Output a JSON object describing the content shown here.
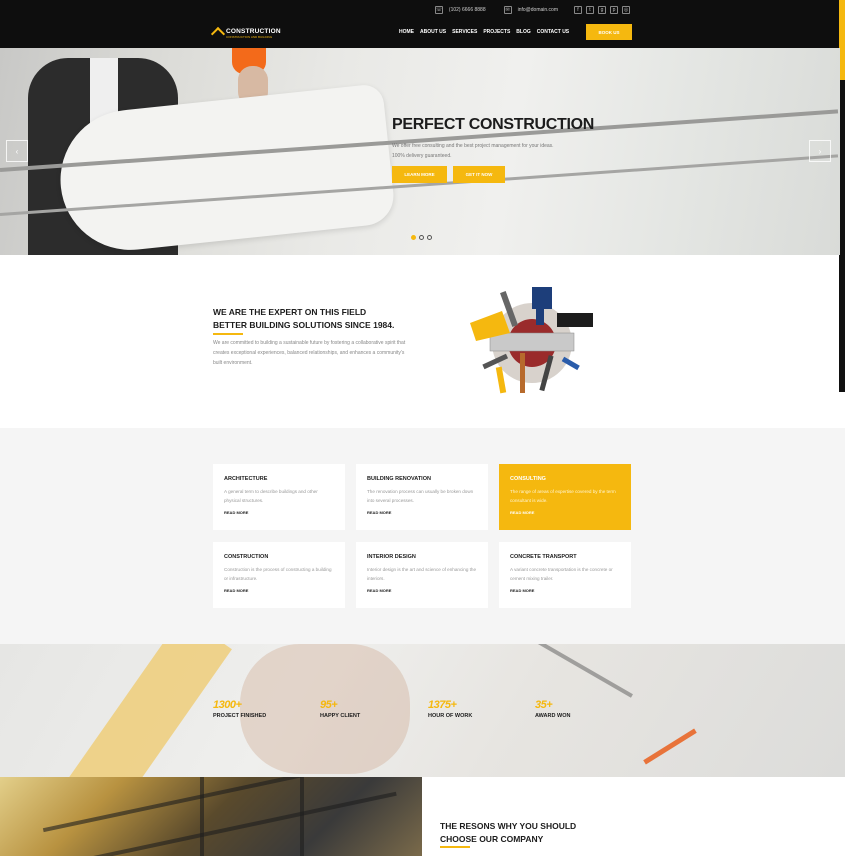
{
  "colors": {
    "accent": "#f5b80f",
    "dark": "#0e0e0e"
  },
  "topbar": {
    "phone_icon": "phone-icon",
    "phone": "(102) 6666 8888",
    "email_icon": "mail-icon",
    "email": "info@domain.com",
    "social": [
      {
        "icon": "facebook-icon",
        "glyph": "f"
      },
      {
        "icon": "twitter-icon",
        "glyph": "t"
      },
      {
        "icon": "google-plus-icon",
        "glyph": "g"
      },
      {
        "icon": "pinterest-icon",
        "glyph": "p"
      },
      {
        "icon": "instagram-icon",
        "glyph": "◎"
      }
    ]
  },
  "logo": {
    "name": "CONSTRUCTION",
    "tagline": "CONSTRUCTION AND BUILDING"
  },
  "nav": {
    "items": [
      "HOME",
      "ABOUT US",
      "SERVICES",
      "PROJECTS",
      "BLOG",
      "CONTACT US"
    ],
    "cta": "BOOK US"
  },
  "hero": {
    "title": "PERFECT CONSTRUCTION",
    "text": "We offer free consulting and the best project management for your ideas. 100% delivery guaranteed.",
    "btn_primary": "LEARN MORE",
    "btn_secondary": "GET IT NOW",
    "prev": "‹",
    "next": "›"
  },
  "about": {
    "title_line1": "WE ARE THE EXPERT ON THIS FIELD",
    "title_line2": "BETTER BUILDING SOLUTIONS SINCE 1984.",
    "text": "We are committed to building a sustainable future by fostering a collaborative spirit that creates exceptional experiences, balanced relationships, and enhances a community's built environment."
  },
  "services": [
    {
      "title": "ARCHITECTURE",
      "desc": "A general term to describe buildings and other physical structures.",
      "more": "READ MORE"
    },
    {
      "title": "BUILDING RENOVATION",
      "desc": "The renovation process can usually be broken down into several processes.",
      "more": "READ MORE"
    },
    {
      "title": "CONSULTING",
      "desc": "The range of areas of expertise covered by the term consultant is wide.",
      "more": "READ MORE"
    },
    {
      "title": "CONSTRUCTION",
      "desc": "Construction is the process of constructing a building or infrastructure.",
      "more": "READ MORE"
    },
    {
      "title": "INTERIOR DESIGN",
      "desc": "Interior design is the art and science of enhancing the interiors.",
      "more": "READ MORE"
    },
    {
      "title": "CONCRETE TRANSPORT",
      "desc": "A variant concrete transportation is the concrete or cement mixing trailer.",
      "more": "READ MORE"
    }
  ],
  "stats": [
    {
      "num": "1300+",
      "label": "PROJECT FINISHED"
    },
    {
      "num": "95+",
      "label": "HAPPY CLIENT"
    },
    {
      "num": "1375+",
      "label": "HOUR OF WORK"
    },
    {
      "num": "35+",
      "label": "AWARD WON"
    }
  ],
  "why": {
    "title_line1": "THE RESONS WHY YOU SHOULD",
    "title_line2": "CHOOSE OUR COMPANY"
  }
}
